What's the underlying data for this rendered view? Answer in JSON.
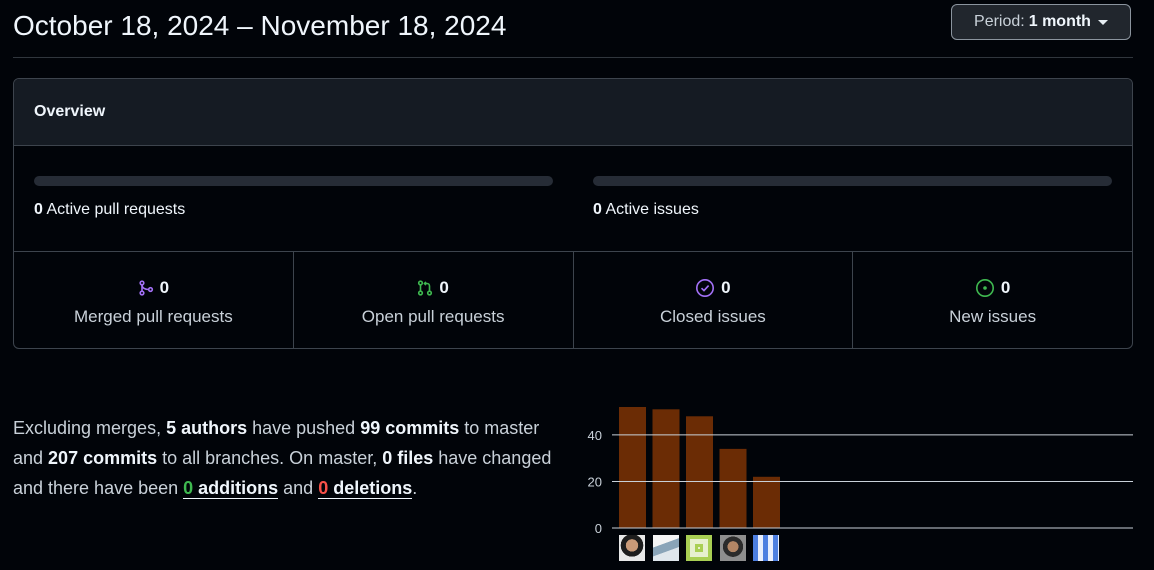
{
  "header": {
    "title": "October 18, 2024 – November 18, 2024",
    "period_label": "Period:",
    "period_value": "1 month"
  },
  "overview": {
    "heading": "Overview",
    "active_pull_requests": {
      "count": "0",
      "label": "Active pull requests"
    },
    "active_issues": {
      "count": "0",
      "label": "Active issues"
    },
    "cells": [
      {
        "count": "0",
        "label": "Merged pull requests",
        "icon": "merged-pr-icon",
        "color": "#a371f7"
      },
      {
        "count": "0",
        "label": "Open pull requests",
        "icon": "open-pr-icon",
        "color": "#3fb950"
      },
      {
        "count": "0",
        "label": "Closed issues",
        "icon": "closed-issue-icon",
        "color": "#a371f7"
      },
      {
        "count": "0",
        "label": "New issues",
        "icon": "new-issue-icon",
        "color": "#3fb950"
      }
    ]
  },
  "summary": {
    "t1": "Excluding merges, ",
    "authors": "5 authors",
    "t2": " have pushed ",
    "commits": "99 commits",
    "t3": " to master and ",
    "all_commits": "207 commits",
    "t4": " to all branches. On master, ",
    "files": "0 files",
    "t5": " have changed and there have been ",
    "additions_num": "0",
    "additions_word": " additions",
    "t6": " and ",
    "deletions_num": "0",
    "deletions_word": " deletions",
    "t7": "."
  },
  "chart_data": {
    "type": "bar",
    "categories": [
      "author-1",
      "author-2",
      "author-3",
      "author-4",
      "author-5"
    ],
    "values": [
      52,
      51,
      48,
      34,
      22
    ],
    "ylim": [
      0,
      55
    ],
    "yticks": [
      0,
      20,
      40
    ],
    "bar_color": "#6b2c05",
    "grid": true
  }
}
